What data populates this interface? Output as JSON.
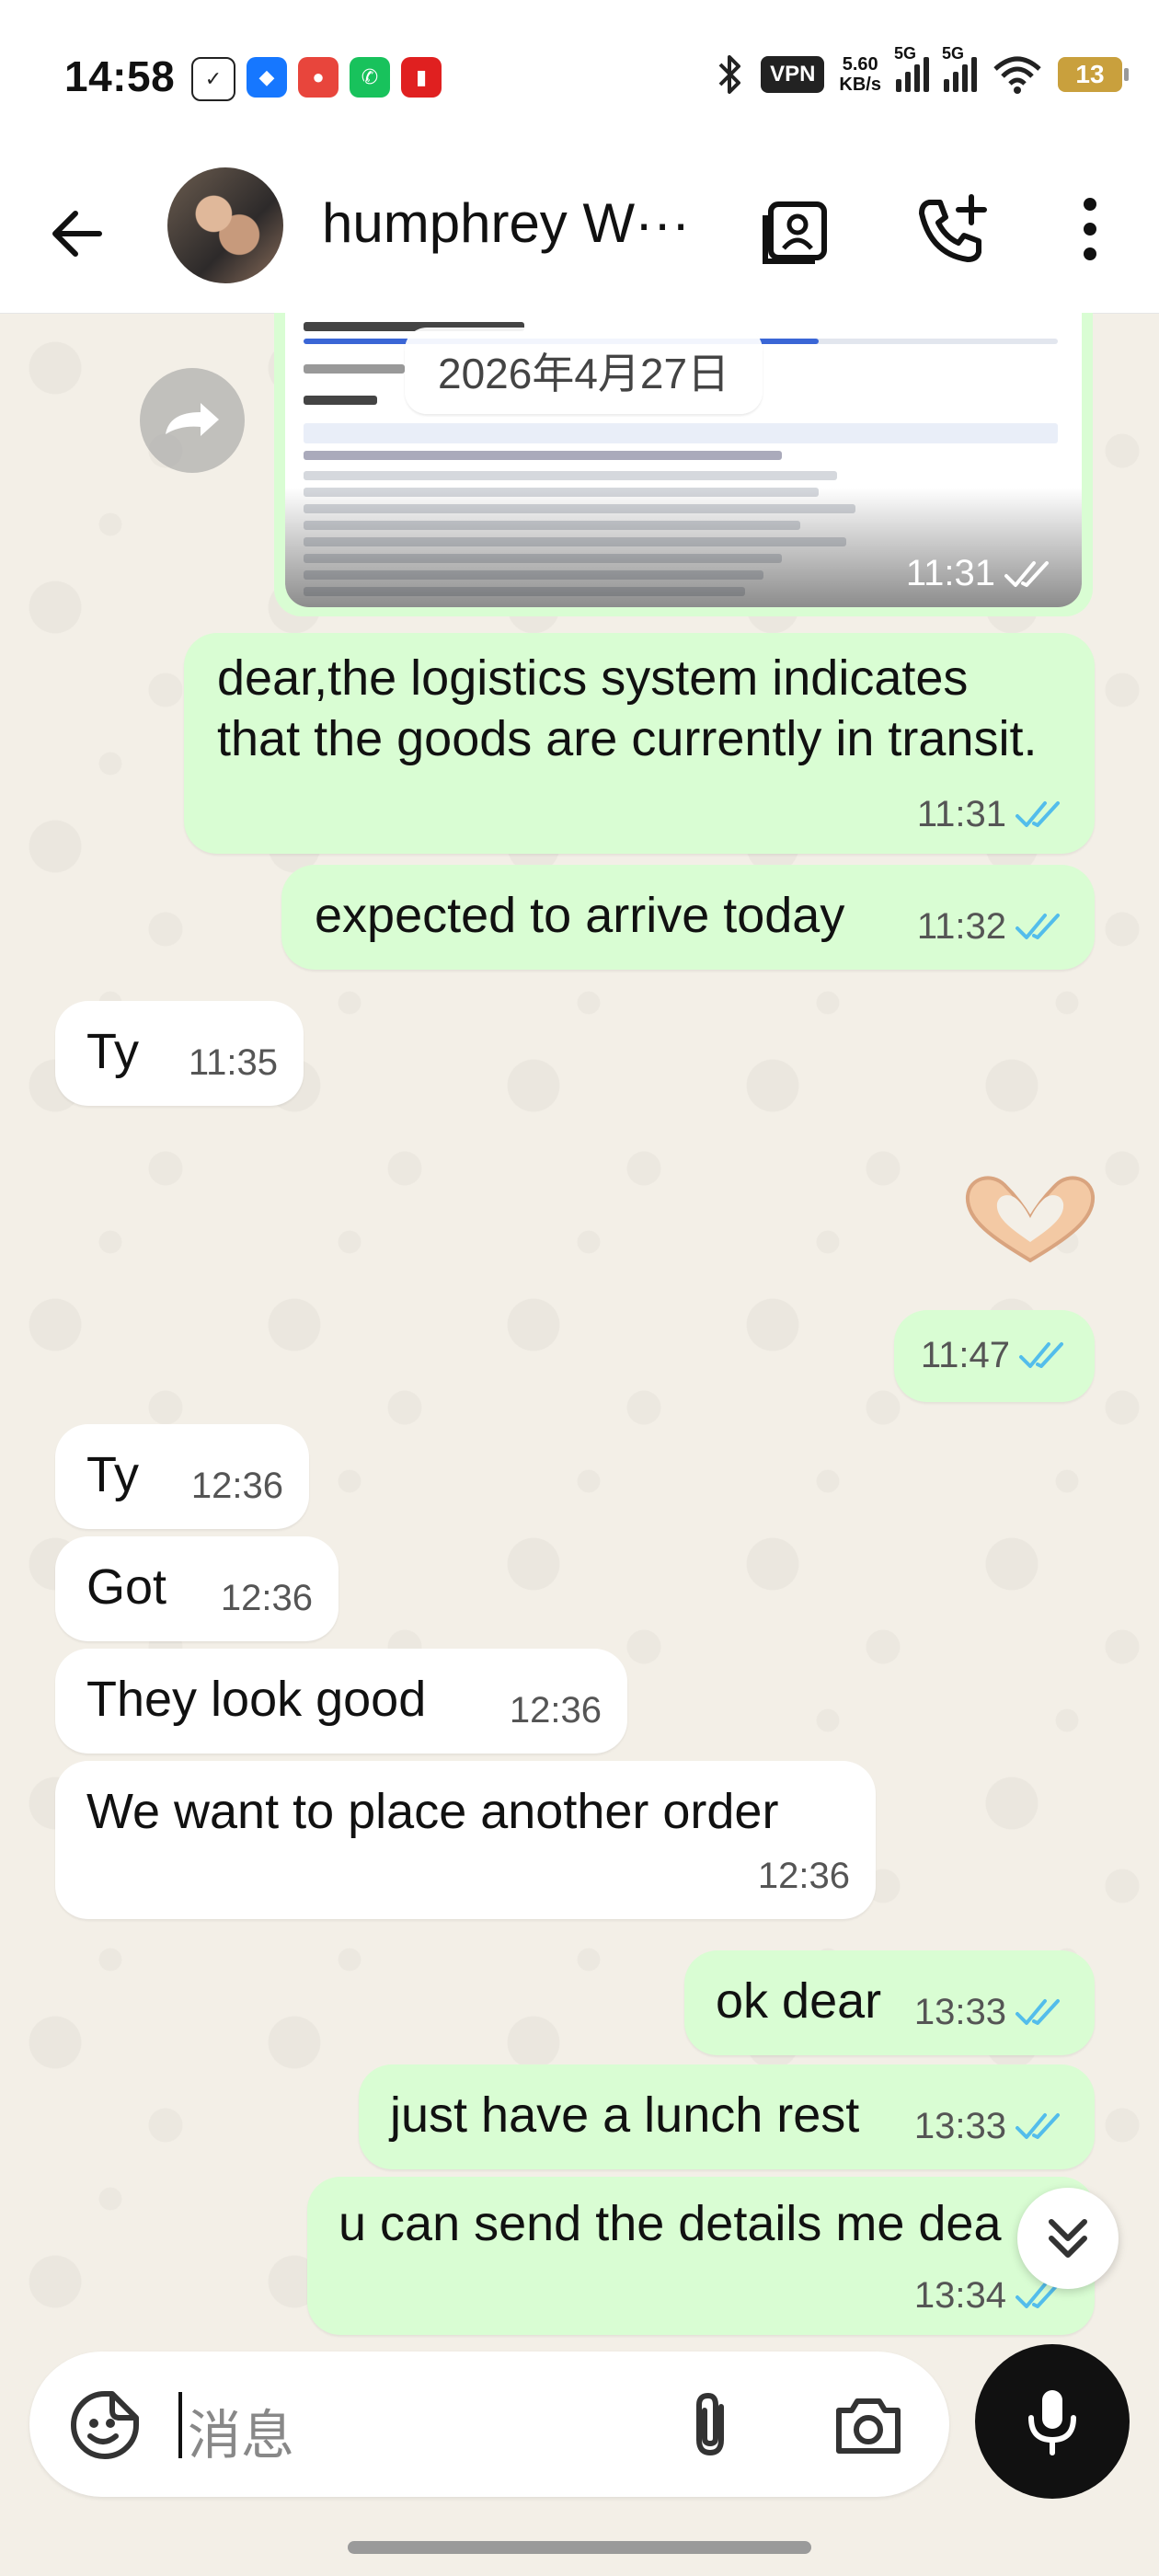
{
  "status_bar": {
    "time": "14:58",
    "vpn": "VPN",
    "speed_value": "5.60",
    "speed_unit": "KB/s",
    "net1": "5G",
    "net2": "5G",
    "battery": "13"
  },
  "header": {
    "contact_name": "humphrey W···"
  },
  "chat": {
    "date_chip": "2026年4月27日",
    "image_message_time": "11:31",
    "messages": [
      {
        "direction": "out",
        "text": "dear,the logistics system indicates that the goods are currently in transit.",
        "time": "11:31"
      },
      {
        "direction": "out",
        "text": "expected to arrive today",
        "time": "11:32"
      },
      {
        "direction": "in",
        "text": "Ty",
        "time": "11:35"
      },
      {
        "direction": "out",
        "text": "",
        "time": "11:47"
      },
      {
        "direction": "in",
        "text": "Ty",
        "time": "12:36"
      },
      {
        "direction": "in",
        "text": "Got",
        "time": "12:36"
      },
      {
        "direction": "in",
        "text": "They look good",
        "time": "12:36"
      },
      {
        "direction": "in",
        "text": "We want to place another order",
        "time": "12:36"
      },
      {
        "direction": "out",
        "text": "ok dear",
        "time": "13:33"
      },
      {
        "direction": "out",
        "text": "just have a lunch rest",
        "time": "13:33"
      },
      {
        "direction": "out",
        "text": "u can send the details me dea",
        "time": "13:34"
      }
    ]
  },
  "input": {
    "placeholder": "消息"
  },
  "colors": {
    "outgoing_bubble": "#d9fdd3",
    "incoming_bubble": "#ffffff",
    "read_ticks": "#53bdeb",
    "wallpaper": "#f3efe7"
  },
  "icons": {
    "back": "arrow-left-icon",
    "contact_card": "contact-card-icon",
    "add_call": "phone-plus-icon",
    "menu": "more-vertical-icon",
    "sticker": "sticker-icon",
    "attach": "paperclip-icon",
    "camera": "camera-icon",
    "mic": "microphone-icon",
    "forward": "forward-icon",
    "scroll_down": "double-chevron-down-icon"
  }
}
